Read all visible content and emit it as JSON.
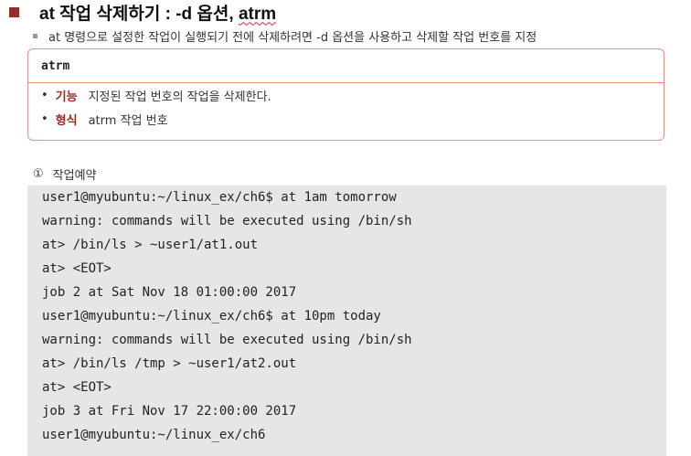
{
  "header": {
    "title": "at 작업 삭제하기 : -d 옵션, ",
    "title_underlined": "atrm"
  },
  "description": "at 명령으로 설정한 작업이 실행되기 전에 삭제하려면 -d 옵션을 사용하고 삭제할 작업 번호를 지정",
  "syntax_box": {
    "command": "atrm",
    "rows": [
      {
        "bullet": "•",
        "label": "기능",
        "text": "지정된 작업 번호의 작업을 삭제한다."
      },
      {
        "bullet": "•",
        "label": "형식",
        "text": "atrm 작업 번호"
      }
    ]
  },
  "step": {
    "number": "①",
    "label": "작업예약"
  },
  "terminal": {
    "lines": [
      "user1@myubuntu:~/linux_ex/ch6$ at 1am tomorrow",
      "warning: commands will be executed using /bin/sh",
      "at> /bin/ls > ~user1/at1.out",
      "at> <EOT>",
      "job 2 at Sat Nov 18 01:00:00 2017",
      "user1@myubuntu:~/linux_ex/ch6$ at 10pm today",
      "warning: commands will be executed using /bin/sh",
      "at> /bin/ls /tmp > ~user1/at2.out",
      "at> <EOT>",
      "job 3 at Fri Nov 17 22:00:00 2017",
      "user1@myubuntu:~/linux_ex/ch6"
    ]
  }
}
